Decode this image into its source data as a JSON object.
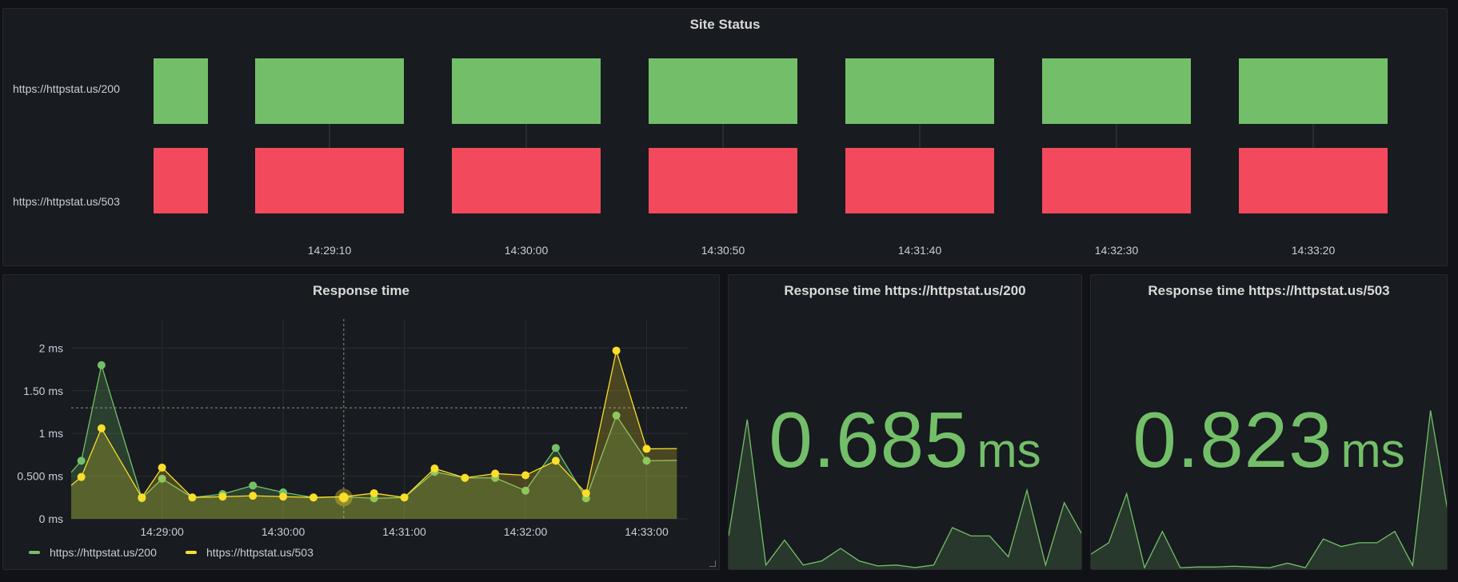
{
  "colors": {
    "green": "#73bf69",
    "red": "#f2495c",
    "yellow": "#fade2a",
    "bg": "#111217",
    "panel": "#181b1f"
  },
  "site_status": {
    "title": "Site Status",
    "rows": [
      {
        "label": "https://httpstat.us/200",
        "state": "up",
        "color": "#73bf69"
      },
      {
        "label": "https://httpstat.us/503",
        "state": "down",
        "color": "#f2495c"
      }
    ],
    "time_ticks": [
      "14:29:10",
      "14:30:00",
      "14:30:50",
      "14:31:40",
      "14:32:30",
      "14:33:20"
    ]
  },
  "response_time": {
    "title": "Response time",
    "resize_icon": "resize-handle-icon",
    "chart_data": {
      "type": "line",
      "x": [
        "14:28:20",
        "14:28:30",
        "14:28:50",
        "14:29:00",
        "14:29:15",
        "14:29:30",
        "14:29:45",
        "14:30:00",
        "14:30:15",
        "14:30:30",
        "14:30:45",
        "14:31:00",
        "14:31:15",
        "14:31:30",
        "14:31:45",
        "14:32:00",
        "14:32:15",
        "14:32:30",
        "14:32:45",
        "14:33:00",
        "14:33:15"
      ],
      "series": [
        {
          "name": "https://httpstat.us/200",
          "color": "#73bf69",
          "values": [
            0.68,
            1.8,
            0.24,
            0.47,
            0.25,
            0.29,
            0.39,
            0.31,
            0.25,
            0.26,
            0.24,
            0.25,
            0.55,
            0.48,
            0.48,
            0.33,
            0.83,
            0.24,
            1.21,
            0.68,
            0.685
          ]
        },
        {
          "name": "https://httpstat.us/503",
          "color": "#fade2a",
          "values": [
            0.49,
            1.06,
            0.25,
            0.6,
            0.25,
            0.26,
            0.27,
            0.26,
            0.25,
            0.26,
            0.3,
            0.25,
            0.59,
            0.48,
            0.53,
            0.51,
            0.68,
            0.3,
            1.97,
            0.82,
            0.823
          ]
        }
      ],
      "yticks": [
        "0 ms",
        "0.500 ms",
        "1 ms",
        "1.50 ms",
        "2 ms"
      ],
      "xticks": [
        "14:29:00",
        "14:30:00",
        "14:31:00",
        "14:32:00",
        "14:33:00"
      ],
      "ylim": [
        0,
        2.2
      ],
      "legend": "bottom-left",
      "grid": true
    }
  },
  "stat_200": {
    "title": "Response time https://httpstat.us/200",
    "value": "0.685",
    "unit": "ms",
    "sparkline": [
      0.4,
      1.8,
      0.05,
      0.35,
      0.05,
      0.1,
      0.25,
      0.1,
      0.04,
      0.05,
      0.02,
      0.05,
      0.5,
      0.4,
      0.4,
      0.15,
      0.95,
      0.05,
      0.8,
      0.4
    ]
  },
  "stat_503": {
    "title": "Response time https://httpstat.us/503",
    "value": "0.823",
    "unit": "ms",
    "sparkline": [
      0.2,
      0.35,
      1.0,
      0.02,
      0.5,
      0.02,
      0.03,
      0.03,
      0.04,
      0.03,
      0.02,
      0.08,
      0.02,
      0.4,
      0.3,
      0.35,
      0.35,
      0.5,
      0.05,
      2.1,
      0.72
    ]
  }
}
